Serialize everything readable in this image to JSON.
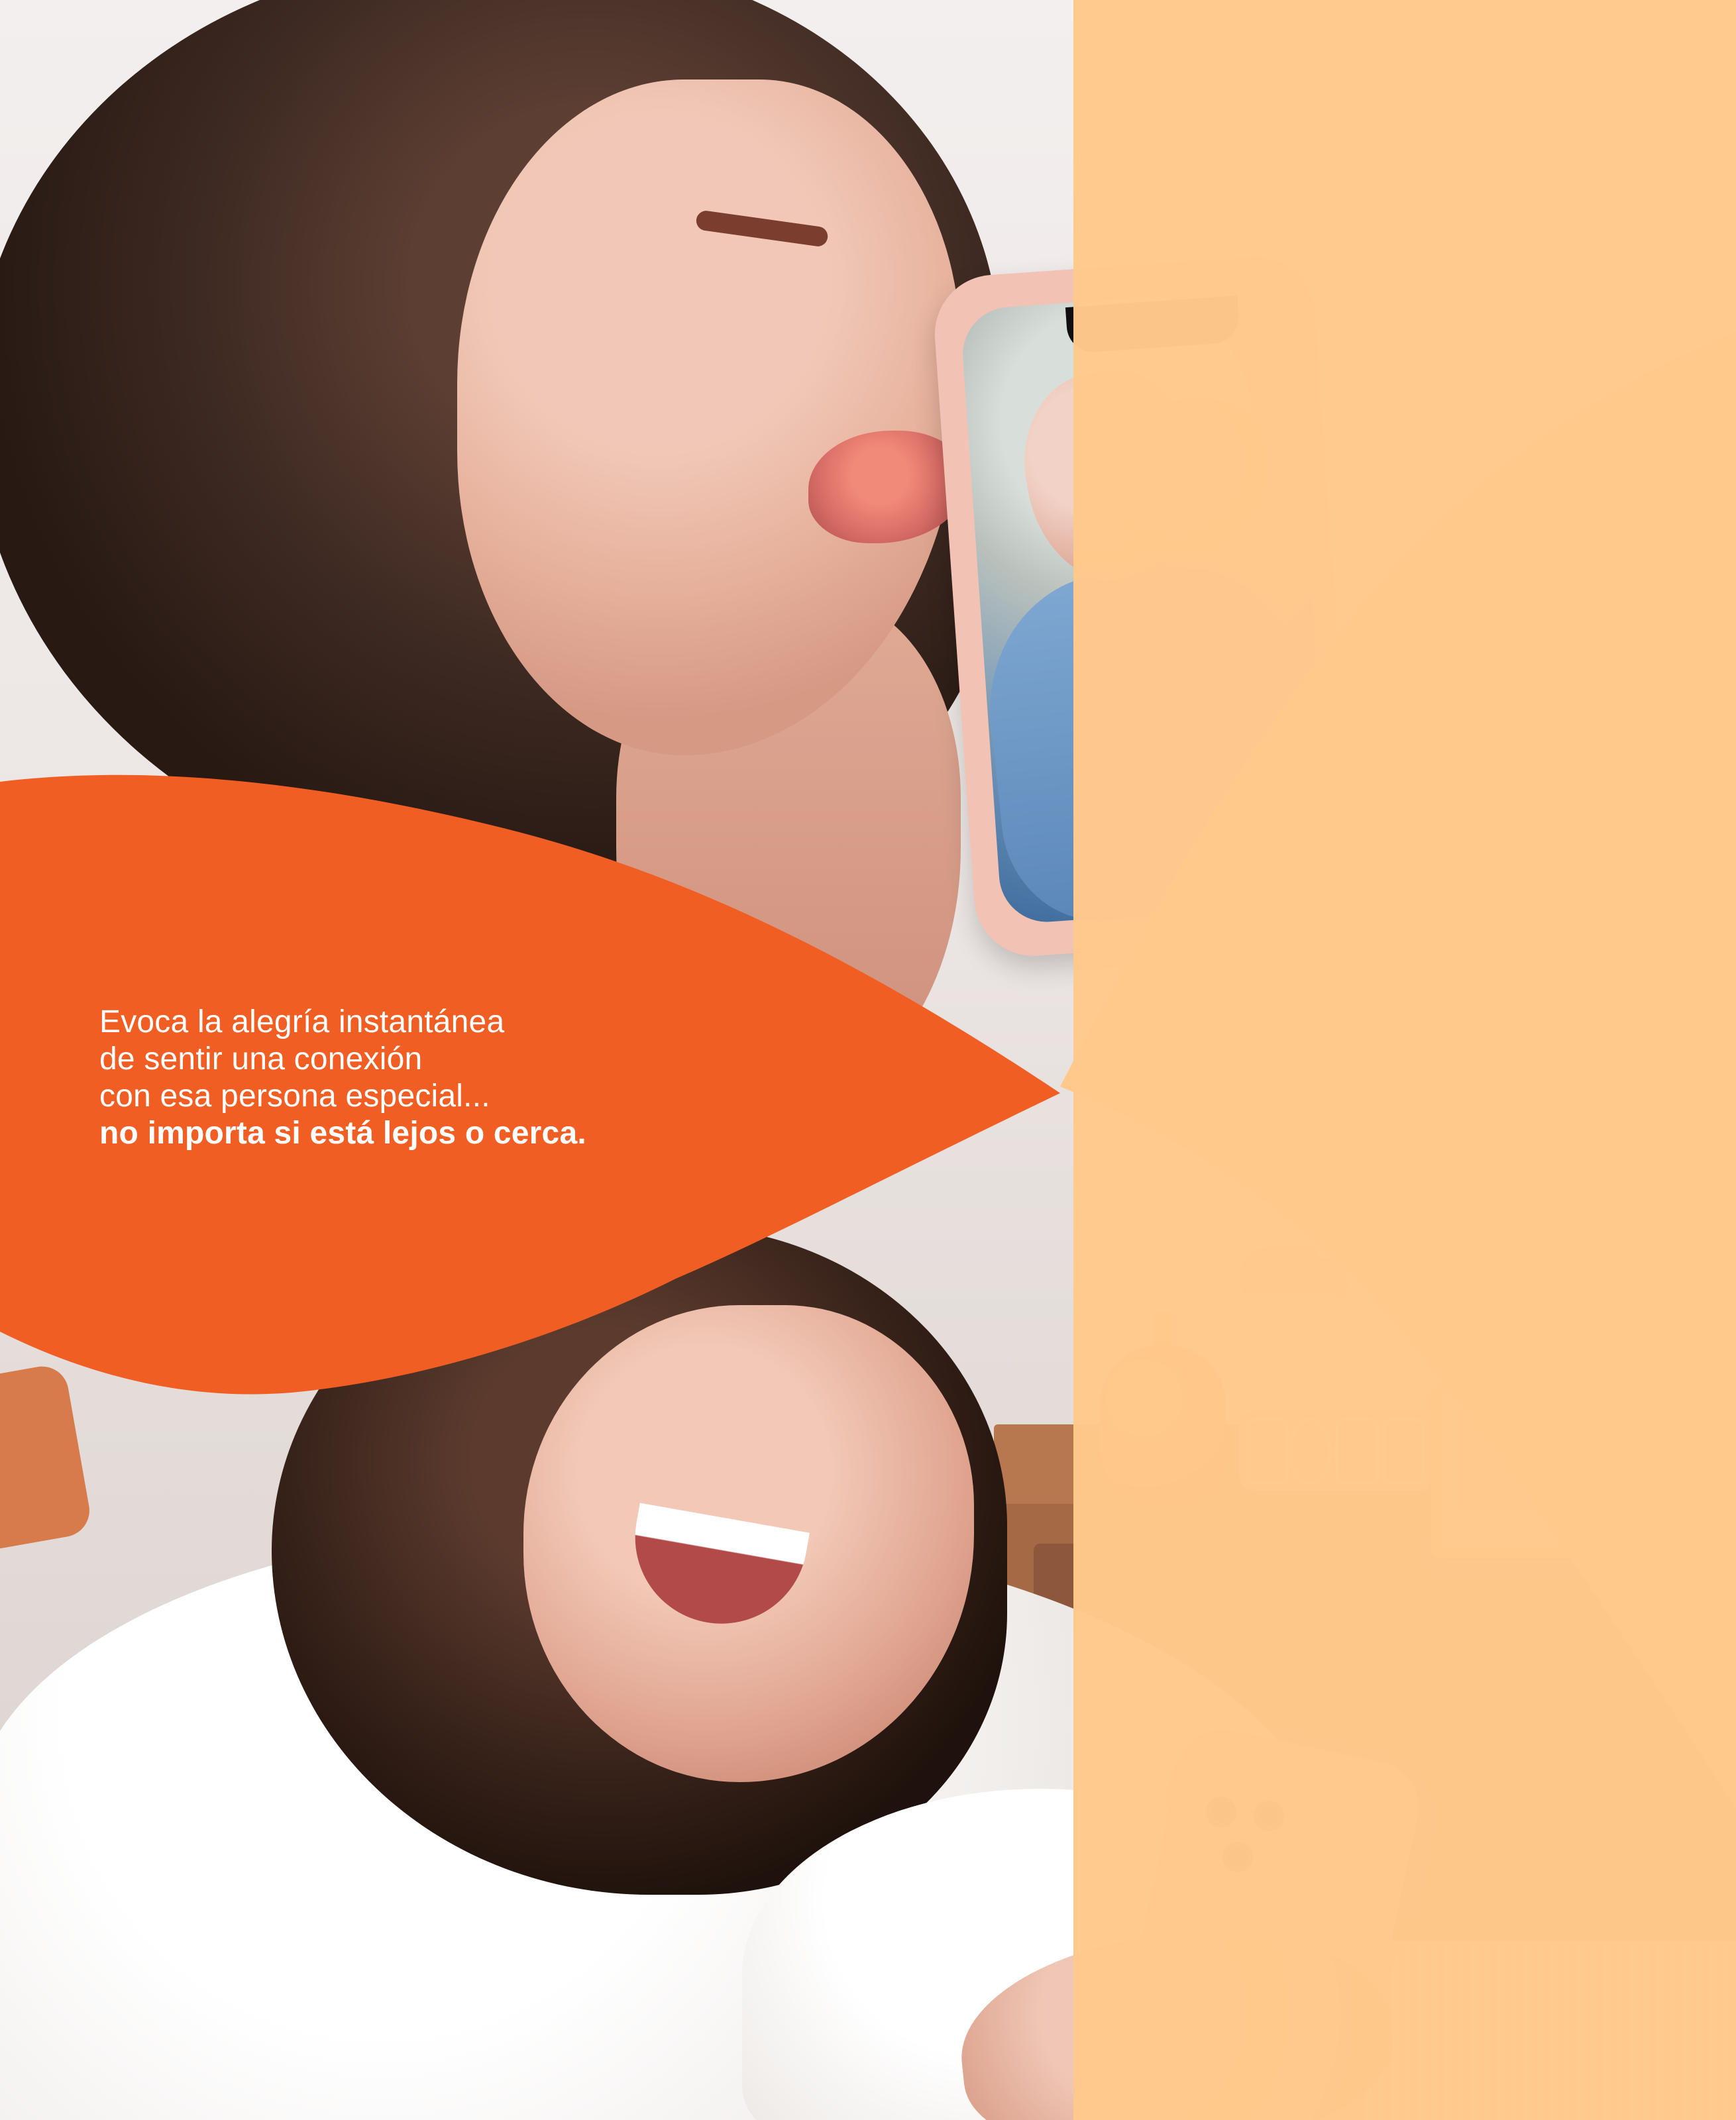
{
  "copy": {
    "line1": "Evoca la alegría instantánea",
    "line2": "de sentir una conexión",
    "line3": "con esa persona especial...",
    "line4_bold": "no importa si está lejos o cerca."
  },
  "colors": {
    "orange_shape": "#f05e23",
    "peach_shape": "#ffc98c",
    "text": "#ffffff"
  }
}
